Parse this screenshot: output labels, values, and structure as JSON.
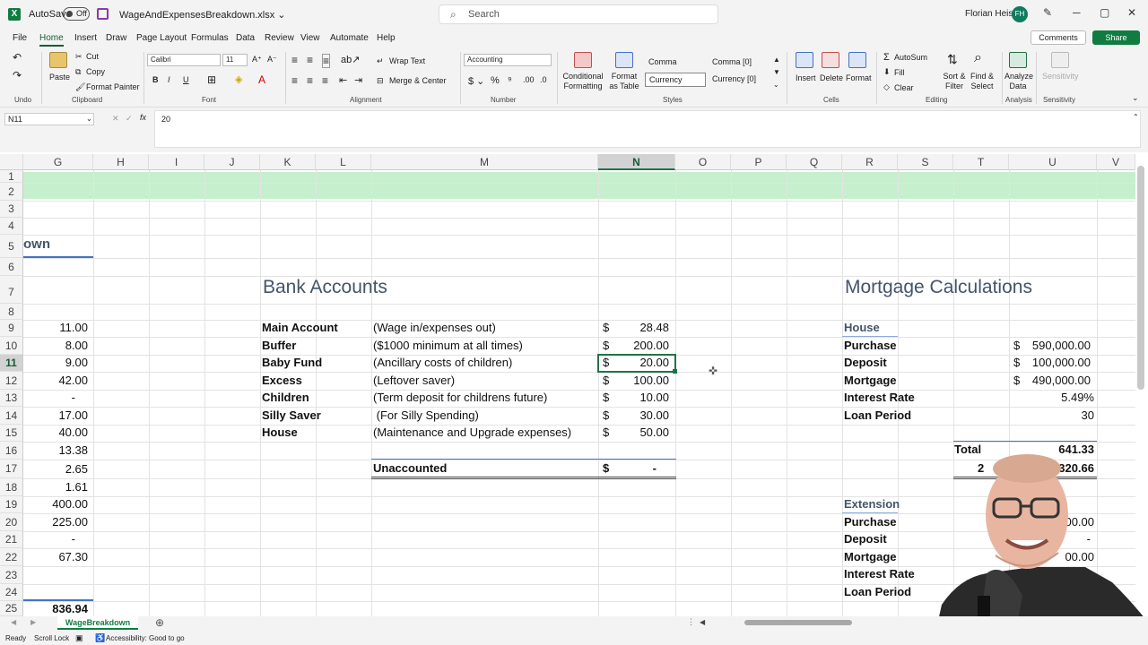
{
  "app": {
    "autosave_label": "AutoSave",
    "autosave_state": "Off",
    "file_name": "WageAndExpensesBreakdown.xlsx ⌄",
    "search_placeholder": "Search",
    "user_name": "Florian Heise",
    "user_initials": "FH"
  },
  "menu": [
    "File",
    "Home",
    "Insert",
    "Draw",
    "Page Layout",
    "Formulas",
    "Data",
    "Review",
    "View",
    "Automate",
    "Help"
  ],
  "menu_active": "Home",
  "comments_label": "Comments",
  "share_label": "Share",
  "ribbon": {
    "undo": "Undo",
    "paste": "Paste",
    "cut": "Cut",
    "copy": "Copy",
    "format_painter": "Format Painter",
    "clipboard": "Clipboard",
    "font_name": "Calibri",
    "font_size": "11",
    "font": "Font",
    "wrap_text": "Wrap Text",
    "merge_center": "Merge & Center",
    "alignment": "Alignment",
    "number_format": "Accounting",
    "number": "Number",
    "cond_format": "Conditional Formatting",
    "format_table": "Format as Table",
    "style_comma": "Comma",
    "style_comma0": "Comma [0]",
    "style_currency": "Currency",
    "style_currency0": "Currency [0]",
    "styles": "Styles",
    "insert": "Insert",
    "delete": "Delete",
    "format": "Format",
    "cells": "Cells",
    "autosum": "AutoSum",
    "fill": "Fill",
    "clear": "Clear",
    "sort_filter": "Sort & Filter",
    "find_select": "Find & Select",
    "editing": "Editing",
    "analyze_data": "Analyze Data",
    "analysis": "Analysis",
    "sensitivity": "Sensitivity"
  },
  "formula_bar": {
    "name_box": "N11",
    "fx": "fx",
    "value": "20"
  },
  "columns": [
    "G",
    "H",
    "I",
    "J",
    "K",
    "L",
    "M",
    "N",
    "O",
    "P",
    "Q",
    "R",
    "S",
    "T",
    "U",
    "V"
  ],
  "selected_column": "N",
  "selected_row": "11",
  "rows": [
    "1",
    "2",
    "3",
    "4",
    "5",
    "6",
    "7",
    "8",
    "9",
    "10",
    "11",
    "12",
    "13",
    "14",
    "15",
    "16",
    "17",
    "18",
    "19",
    "20",
    "21",
    "22",
    "23",
    "24",
    "25"
  ],
  "sheet": {
    "title_fragment": "own",
    "col_g": [
      "11.00",
      "8.00",
      "9.00",
      "42.00",
      "-",
      "17.00",
      "40.00",
      "13.38",
      "2.65",
      "1.61",
      "400.00",
      "225.00",
      "-",
      "67.30",
      "836.94"
    ],
    "bank": {
      "heading": "Bank Accounts",
      "items": [
        {
          "name": "Main Account",
          "desc": "(Wage in/expenses out)",
          "cur": "$",
          "amt": "28.48"
        },
        {
          "name": "Buffer",
          "desc": "($1000 minimum at all times)",
          "cur": "$",
          "amt": "200.00"
        },
        {
          "name": "Baby Fund",
          "desc": "(Ancillary costs of children)",
          "cur": "$",
          "amt": "20.00"
        },
        {
          "name": "Excess",
          "desc": "(Leftover saver)",
          "cur": "$",
          "amt": "100.00"
        },
        {
          "name": "Children",
          "desc": "(Term deposit for childrens future)",
          "cur": "$",
          "amt": "10.00"
        },
        {
          "name": "Silly Saver",
          "desc": " (For Silly Spending)",
          "cur": "$",
          "amt": "30.00"
        },
        {
          "name": "House",
          "desc": "(Maintenance and Upgrade expenses)",
          "cur": "$",
          "amt": "50.00"
        }
      ],
      "unaccounted": "Unaccounted",
      "unaccounted_cur": "$",
      "unaccounted_amt": "-"
    },
    "mortgage": {
      "heading": "Mortgage Calculations",
      "house": "House",
      "items": [
        {
          "name": "Purchase",
          "cur": "$",
          "amt": "590,000.00"
        },
        {
          "name": "Deposit",
          "cur": "$",
          "amt": "100,000.00"
        },
        {
          "name": "Mortgage",
          "cur": "$",
          "amt": "490,000.00"
        },
        {
          "name": "Interest Rate",
          "cur": "",
          "amt": "5.49%"
        },
        {
          "name": "Loan Period",
          "cur": "",
          "amt": "30"
        }
      ],
      "total_label": "Total",
      "total_val": "641.33",
      "total_row2_prefix": "2",
      "total_row2_val": "320.66",
      "extension": "Extension",
      "ext_items": [
        {
          "name": "Purchase",
          "amt": "000.00"
        },
        {
          "name": "Deposit",
          "amt": "-"
        },
        {
          "name": "Mortgage",
          "amt": "00.00"
        },
        {
          "name": "Interest Rate",
          "amt": ""
        },
        {
          "name": "Loan Period",
          "amt": ""
        }
      ]
    }
  },
  "sheet_tab": "WageBreakdown",
  "status": {
    "ready": "Ready",
    "scroll_lock": "Scroll Lock",
    "accessibility": "Accessibility: Good to go"
  }
}
